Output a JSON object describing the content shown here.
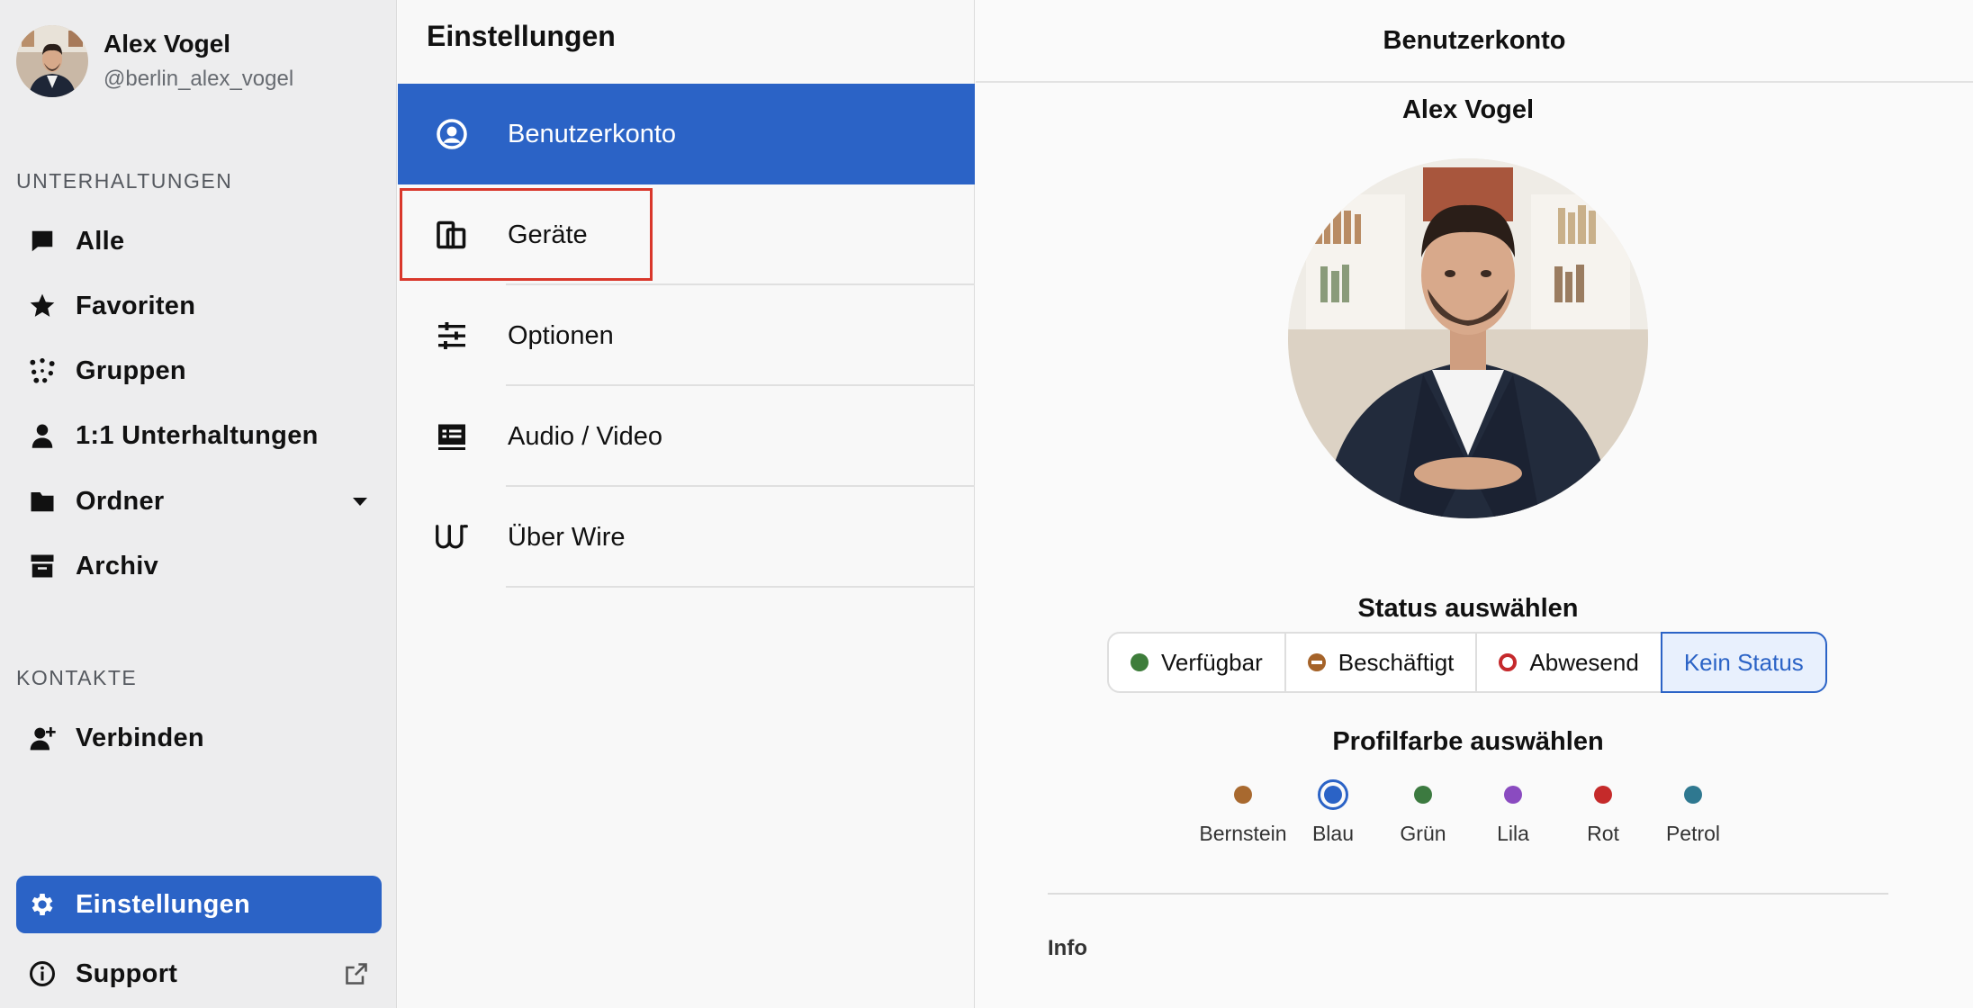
{
  "user": {
    "name": "Alex Vogel",
    "handle": "@berlin_alex_vogel"
  },
  "sidebar": {
    "conversations_label": "UNTERHALTUNGEN",
    "items": [
      {
        "label": "Alle",
        "icon": "chat-bubble-icon"
      },
      {
        "label": "Favoriten",
        "icon": "star-icon"
      },
      {
        "label": "Gruppen",
        "icon": "group-dots-icon"
      },
      {
        "label": "1:1 Unterhaltungen",
        "icon": "person-icon"
      },
      {
        "label": "Ordner",
        "icon": "folder-icon"
      },
      {
        "label": "Archiv",
        "icon": "archive-icon"
      }
    ],
    "contacts_label": "KONTAKTE",
    "connect_label": "Verbinden",
    "settings_label": "Einstellungen",
    "support_label": "Support"
  },
  "settings_menu": {
    "title": "Einstellungen",
    "items": [
      {
        "label": "Benutzerkonto",
        "icon": "account-circle-icon",
        "active": true
      },
      {
        "label": "Geräte",
        "icon": "devices-icon"
      },
      {
        "label": "Optionen",
        "icon": "sliders-icon"
      },
      {
        "label": "Audio / Video",
        "icon": "av-icon"
      },
      {
        "label": "Über Wire",
        "icon": "wire-logo-icon"
      }
    ]
  },
  "account": {
    "header": "Benutzerkonto",
    "name": "Alex Vogel",
    "status_title": "Status auswählen",
    "statuses": [
      {
        "label": "Verfügbar",
        "color": "#3e7d3b"
      },
      {
        "label": "Beschäftigt",
        "color": "#a56329"
      },
      {
        "label": "Abwesend",
        "color": "#c5292c"
      },
      {
        "label": "Kein Status",
        "selected": true
      }
    ],
    "color_title": "Profilfarbe auswählen",
    "colors": [
      {
        "label": "Bernstein",
        "hex": "#a8692f"
      },
      {
        "label": "Blau",
        "hex": "#2b63c6",
        "selected": true
      },
      {
        "label": "Grün",
        "hex": "#3c7a40"
      },
      {
        "label": "Lila",
        "hex": "#8a4bc0"
      },
      {
        "label": "Rot",
        "hex": "#c52a2a"
      },
      {
        "label": "Petrol",
        "hex": "#2f7890"
      }
    ],
    "info_label": "Info"
  },
  "colors": {
    "accent": "#2b63c6",
    "highlight_box": "#d9372b"
  }
}
